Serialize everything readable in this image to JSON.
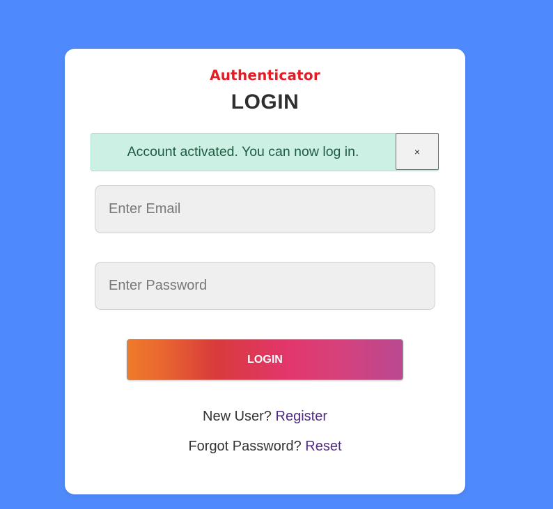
{
  "brand": {
    "name": "Authenticator"
  },
  "page": {
    "title": "LOGIN"
  },
  "alert": {
    "message": "Account activated. You can now log in.",
    "close_label": "×"
  },
  "form": {
    "email": {
      "placeholder": "Enter Email",
      "value": ""
    },
    "password": {
      "placeholder": "Enter Password",
      "value": ""
    },
    "login_button_label": "LOGIN"
  },
  "links": {
    "register": {
      "prompt": "New User?",
      "label": "Register"
    },
    "reset": {
      "prompt": "Forgot Password?",
      "label": "Reset"
    }
  },
  "colors": {
    "background": "#4f8afc",
    "brand": "#e31c25",
    "alert_bg": "#cdf0e4",
    "link": "#4f2a86"
  }
}
